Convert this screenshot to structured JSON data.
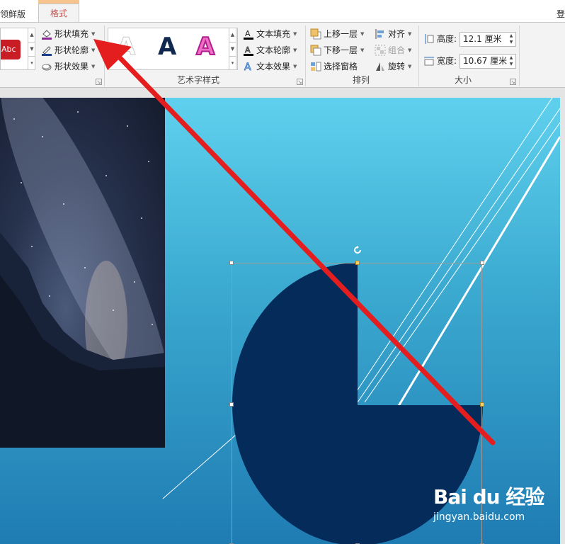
{
  "tabs": {
    "prev_label": "领鲜版",
    "format_label": "格式",
    "login_label": "登"
  },
  "shape_styles": {
    "sample_text": "Abc",
    "fill_label": "形状填充",
    "outline_label": "形状轮廓",
    "effects_label": "形状效果"
  },
  "wordart": {
    "group_label": "艺术字样式",
    "samples": [
      "A",
      "A",
      "A"
    ],
    "text_fill_label": "文本填充",
    "text_outline_label": "文本轮廓",
    "text_effects_label": "文本效果"
  },
  "arrange": {
    "group_label": "排列",
    "bring_forward_label": "上移一层",
    "send_backward_label": "下移一层",
    "selection_pane_label": "选择窗格",
    "align_label": "对齐",
    "group_cmd_label": "组合",
    "rotate_label": "旋转"
  },
  "size": {
    "group_label": "大小",
    "height_label": "高度:",
    "height_value": "12.1 厘米",
    "width_label": "宽度:",
    "width_value": "10.67 厘米"
  },
  "watermark": {
    "logo_text": "Bai du 经验",
    "url": "jingyan.baidu.com"
  },
  "colors": {
    "accent_tab": "#c0504d",
    "shape_fill": "#052b5a",
    "arrow": "#e41e1e"
  }
}
